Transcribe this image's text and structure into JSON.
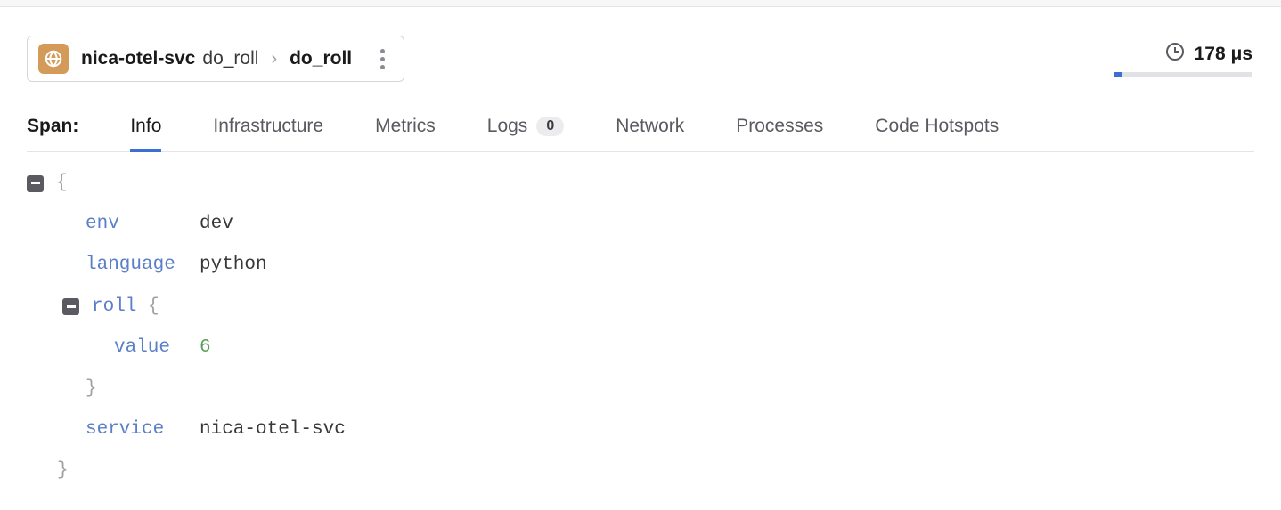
{
  "breadcrumb": {
    "service": "nica-otel-svc",
    "operation": "do_roll",
    "current": "do_roll"
  },
  "duration": {
    "value": "178 μs"
  },
  "tabs": {
    "label": "Span:",
    "items": [
      {
        "label": "Info",
        "active": true
      },
      {
        "label": "Infrastructure"
      },
      {
        "label": "Metrics"
      },
      {
        "label": "Logs",
        "badge": "0"
      },
      {
        "label": "Network"
      },
      {
        "label": "Processes"
      },
      {
        "label": "Code Hotspots"
      }
    ]
  },
  "span_data": {
    "env_key": "env",
    "env_val": "dev",
    "language_key": "language",
    "language_val": "python",
    "roll_key": "roll",
    "roll_value_key": "value",
    "roll_value_val": "6",
    "service_key": "service",
    "service_val": "nica-otel-svc"
  }
}
